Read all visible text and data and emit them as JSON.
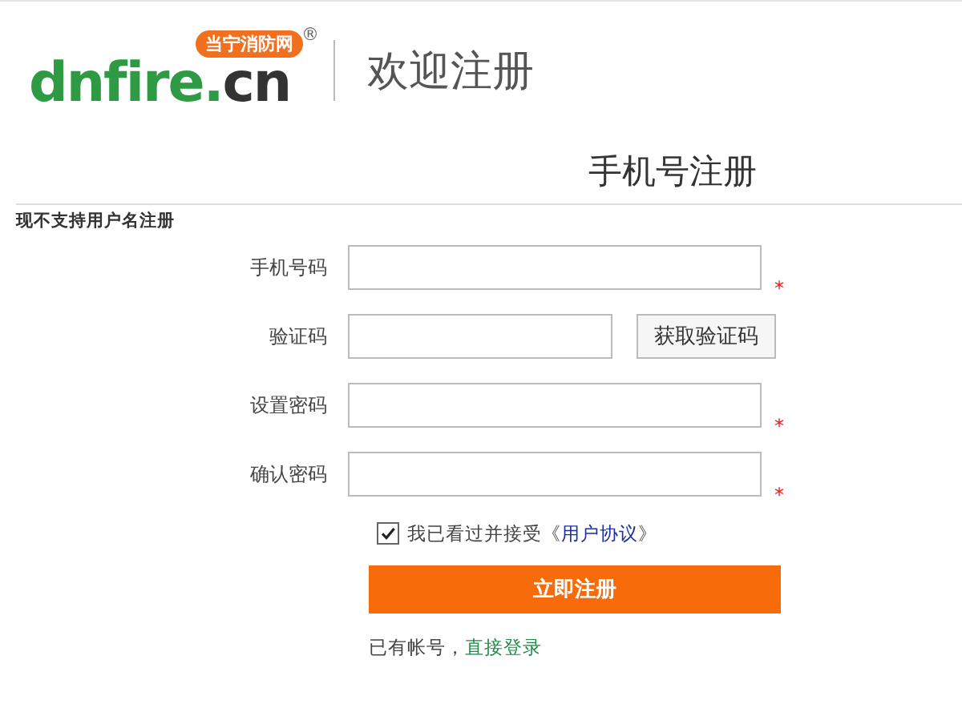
{
  "header": {
    "logo": {
      "name_main": "dnfire",
      "name_dot": ".",
      "name_tld": "cn",
      "badge": "当宁消防网",
      "registered": "®"
    },
    "title": "欢迎注册"
  },
  "section_title": "手机号注册",
  "notice": "现不支持用户名注册",
  "fields": [
    {
      "kind": "input",
      "label": "手机号码",
      "required_mark": "*"
    },
    {
      "kind": "code",
      "label": "验证码",
      "button": "获取验证码"
    },
    {
      "kind": "input",
      "label": "设置密码",
      "required_mark": "*"
    },
    {
      "kind": "input",
      "label": "确认密码",
      "required_mark": "*"
    }
  ],
  "agreement": {
    "checked": true,
    "text": "我已看过并接受《",
    "link": "用户协议",
    "close": "》"
  },
  "submit": "立即注册",
  "login": {
    "text": "已有帐号，",
    "link": "直接登录"
  }
}
